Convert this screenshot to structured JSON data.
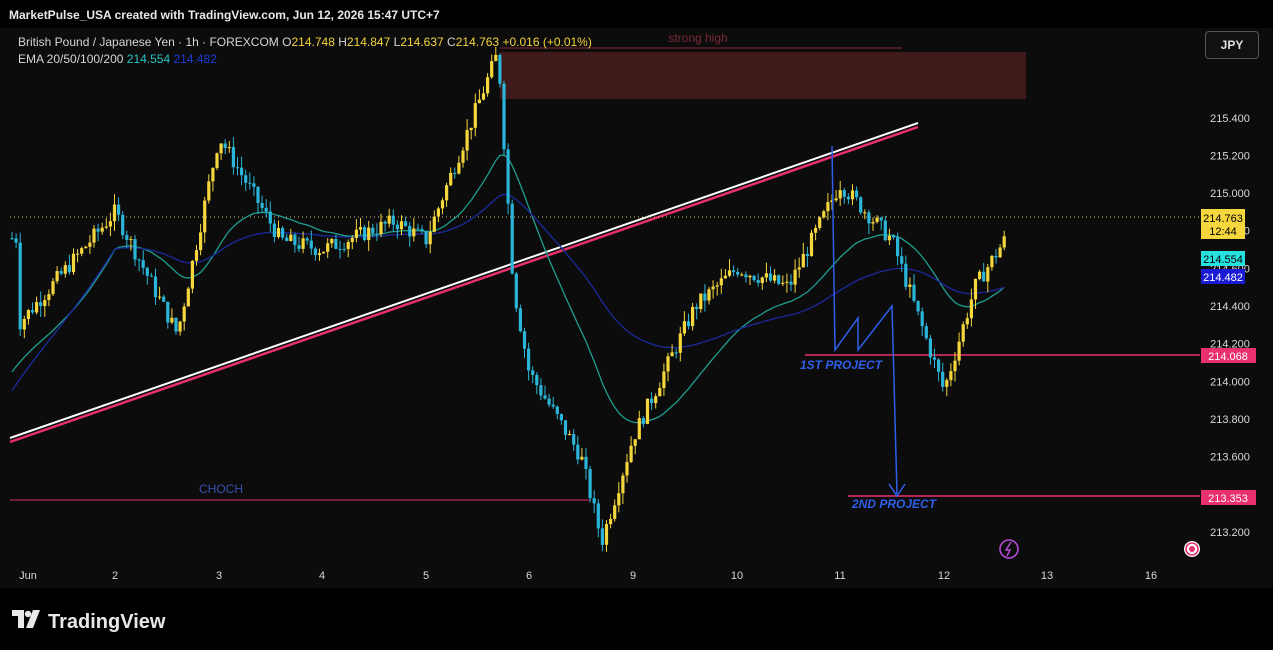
{
  "header": {
    "attribution": "MarketPulse_USA created with TradingView.com, Jun 12, 2026 15:47 UTC+7"
  },
  "legend": {
    "symbol": "British Pound / Japanese Yen · 1h · FOREXCOM",
    "o_label": "O",
    "o_value": "214.748",
    "h_label": "H",
    "h_value": "214.847",
    "l_label": "L",
    "l_value": "214.637",
    "c_label": "C",
    "c_value": "214.763",
    "change": "+0.016 (+0.01%)",
    "ema_label": "EMA 20/50/100/200",
    "ema_value_1": "214.554",
    "ema_value_2": "214.482"
  },
  "currency_button": "JPY",
  "footer": {
    "logo_text": "TradingView"
  },
  "colors": {
    "bull": "#f5d63d",
    "bear": "#2bb5d8",
    "ema_fast": "#1f9e8f",
    "ema_slow": "#1b2a9c",
    "pink": "#e8306e",
    "zone": "#4a1c1e",
    "annotation_blue": "#2f5ee8",
    "price_label": "#f5d63d"
  },
  "chart_data": {
    "type": "candlestick",
    "symbol": "GBPJPY",
    "timeframe": "1h",
    "y_axis": {
      "range": [
        213.05,
        215.75
      ],
      "ticks": [
        "215.400",
        "215.200",
        "215.000",
        "214.800",
        "214.600",
        "214.400",
        "214.200",
        "214.000",
        "213.800",
        "213.600",
        "213.400",
        "213.200"
      ]
    },
    "x_axis": {
      "labels": [
        "Jun",
        "2",
        "3",
        "4",
        "5",
        "6",
        "9",
        "10",
        "11",
        "12",
        "13",
        "16"
      ]
    },
    "price_anchors": [
      {
        "day": "Jun",
        "price": 214.3
      },
      {
        "day": "2",
        "price": 214.9
      },
      {
        "day": "2.6",
        "price": 214.25
      },
      {
        "day": "3",
        "price": 215.3
      },
      {
        "day": "3.6",
        "price": 214.75
      },
      {
        "day": "4",
        "price": 214.7
      },
      {
        "day": "4.7",
        "price": 214.85
      },
      {
        "day": "5",
        "price": 214.75
      },
      {
        "day": "5.7",
        "price": 215.75
      },
      {
        "day": "5.85",
        "price": 214.5
      },
      {
        "day": "6",
        "price": 214.05
      },
      {
        "day": "6.5",
        "price": 213.6
      },
      {
        "day": "6.7",
        "price": 213.15
      },
      {
        "day": "9",
        "price": 213.7
      },
      {
        "day": "9.6",
        "price": 214.4
      },
      {
        "day": "10",
        "price": 214.6
      },
      {
        "day": "10.5",
        "price": 214.5
      },
      {
        "day": "11",
        "price": 215.05
      },
      {
        "day": "11.5",
        "price": 214.75
      },
      {
        "day": "12",
        "price": 213.95
      },
      {
        "day": "12.3",
        "price": 214.5
      },
      {
        "day": "12.6",
        "price": 214.76
      }
    ],
    "ema_fast": {
      "name": "EMA",
      "last": 214.554
    },
    "ema_slow": {
      "name": "EMA",
      "last": 214.482
    },
    "horizontal_levels": [
      {
        "price": 214.068,
        "label": "214.068",
        "annotation": "1ST PROJECT"
      },
      {
        "price": 213.353,
        "label": "213.353",
        "annotation": "2ND PROJECT"
      },
      {
        "price": 213.34,
        "annotation": "CHOCH"
      }
    ],
    "zone": {
      "label": "strong high",
      "low": 215.37,
      "high": 215.75
    },
    "trendline": {
      "from": {
        "price": 213.6
      },
      "to": {
        "price": 215.2
      }
    },
    "last_price": {
      "value": "214.763",
      "countdown": "12:44"
    },
    "ema_labels": [
      "214.554",
      "214.482"
    ]
  }
}
